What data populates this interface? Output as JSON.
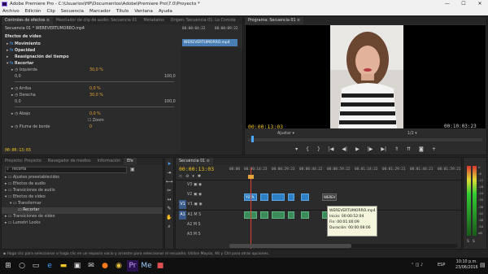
{
  "window": {
    "title": "Adobe Premiere Pro - C:\\Usuarios\\HP\\Documentos\\Adobe\\Premiere Pro\\7.0\\Proyecto *",
    "minimize": "—",
    "maximize": "☐",
    "close": "✕"
  },
  "menu": [
    "Archivo",
    "Edición",
    "Clip",
    "Secuencia",
    "Marcador",
    "Título",
    "Ventana",
    "Ayuda"
  ],
  "effect_controls": {
    "tabs": [
      "Controles de efectos ≡",
      "Mezclador de clip de audio: Secuencia 01",
      "Metadatos",
      "Origen: Secuencia 01: La Comida"
    ],
    "clip_path": "Secuencia 01 * WEREVERTUMORRO.mp4",
    "ruler_times": [
      "00:00:04:22",
      "00:00:09:22"
    ],
    "clip_label": "WEREVERTUMORRO.mp4",
    "section": "Efectos de vídeo",
    "rows": [
      {
        "label": "Movimiento",
        "fx": "fx"
      },
      {
        "label": "Opacidad",
        "fx": "fx"
      },
      {
        "label": "Reasignación del tiempo",
        "fx": ""
      },
      {
        "label": "Recortar",
        "fx": "fx"
      }
    ],
    "params": [
      {
        "label": "Izquierda",
        "value": "30,0 %",
        "min": "0,0",
        "max": "100,0"
      },
      {
        "label": "Arriba",
        "value": "0,0 %"
      },
      {
        "label": "Derecha",
        "value": "30,0 %",
        "min": "0,0",
        "max": "100,0"
      },
      {
        "label": "Abajo",
        "value": "0,0 %"
      },
      {
        "label": "Pluma de borde",
        "value": "0"
      }
    ],
    "zoom_label": "Zoom",
    "timecode": "00:00:13:03"
  },
  "program_monitor": {
    "tab": "Programa: Secuencia 01 ≡",
    "timecode": "00:00:13:03",
    "fit": "Ajustar",
    "resolution": "1/2",
    "duration": "00:10:03:23"
  },
  "project": {
    "tabs": [
      "Proyecto: Proyecto",
      "Navegador de medios",
      "Información",
      "Efe"
    ],
    "search_value": "recorta",
    "tree": [
      {
        "label": "Ajustes preestablecidos",
        "indent": 1
      },
      {
        "label": "Efectos de audio",
        "indent": 1
      },
      {
        "label": "Transiciones de audio",
        "indent": 1
      },
      {
        "label": "Efectos de vídeo",
        "indent": 1
      },
      {
        "label": "Transformar",
        "indent": 2
      },
      {
        "label": "Recortar",
        "indent": 3,
        "selected": true
      },
      {
        "label": "Transiciones de vídeo",
        "indent": 1
      },
      {
        "label": "Lumetri Looks",
        "indent": 1
      }
    ]
  },
  "timeline": {
    "tab": "Secuencia 01 ≡",
    "timecode": "00:00:13:03",
    "ruler": [
      "00:00",
      "00:00:14:23",
      "00:00:29:23",
      "00:00:44:22",
      "00:00:59:22",
      "00:01:14:22",
      "00:01:29:21",
      "00:01:44:21",
      "00:01:59:21"
    ],
    "video_tracks": [
      "V3",
      "V2",
      "V1"
    ],
    "audio_tracks": [
      "A1",
      "A2",
      "A3"
    ],
    "audio_m": "M",
    "audio_s": "S",
    "clips": [
      "YUYA.",
      "WEREV"
    ],
    "tooltip": {
      "name": "WEREVERTUMORRO.mp4",
      "start": "Inicio: 00:00:52:04",
      "end": "Fin: 00:01:00:09",
      "duration": "Duración: 00:00:08:06"
    }
  },
  "audio_meter": {
    "scale": [
      "0",
      "-6",
      "-12",
      "-18",
      "-24",
      "-30",
      "-36",
      "-42",
      "-48",
      "-54",
      "dB"
    ],
    "solo": [
      "S",
      "S"
    ]
  },
  "status_bar": "Haga clic para seleccionar o haga clic en un espacio vacío y arrastre para seleccionar el recuadro. Utilice Mayús, Alt y Ctrl para otras opciones.",
  "taskbar": {
    "search_placeholder": "Escribe aquí para buscar",
    "icons": [
      "windows-icon",
      "search-icon",
      "task-view-icon",
      "edge-icon",
      "file-explorer-icon",
      "store-icon",
      "mail-icon",
      "firefox-icon",
      "chrome-icon",
      "premiere-icon",
      "media-encoder-icon",
      "other-app-icon"
    ],
    "language": "ESP",
    "time": "10:10 p.m.",
    "date": "23/06/2016"
  }
}
